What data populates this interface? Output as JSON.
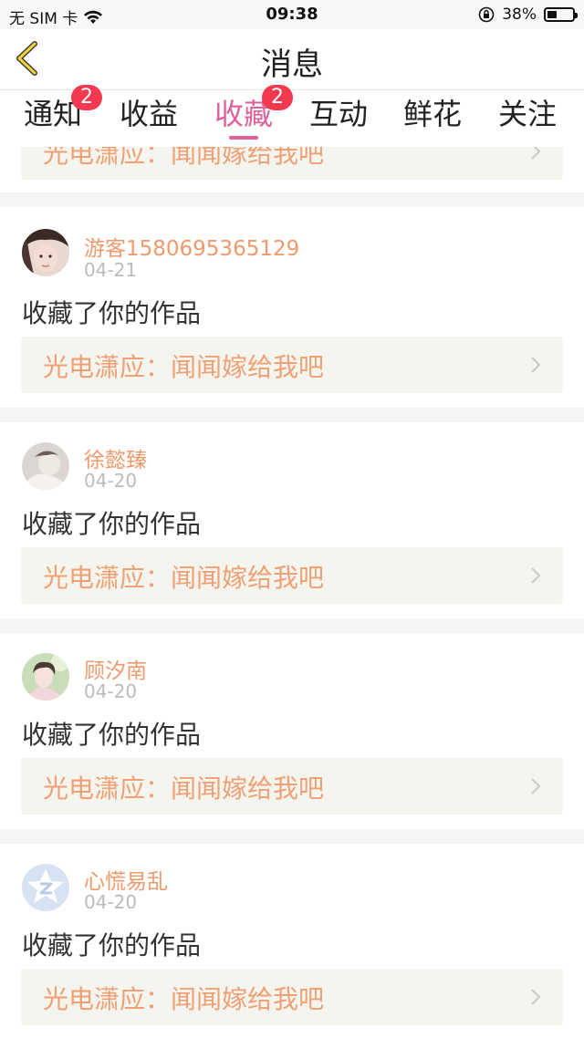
{
  "status_bar": {
    "carrier": "无 SIM 卡",
    "time": "09:38",
    "battery_text": "38%",
    "battery_level": 0.38
  },
  "nav": {
    "title": "消息"
  },
  "tabs": [
    {
      "label": "通知",
      "badge": "2"
    },
    {
      "label": "收益"
    },
    {
      "label": "收藏",
      "badge": "2",
      "active": true
    },
    {
      "label": "互动"
    },
    {
      "label": "鲜花"
    },
    {
      "label": "关注"
    }
  ],
  "partial_card": {
    "work_title": "光电潇应：闻闻嫁给我吧"
  },
  "items": [
    {
      "user": "游客1580695365129",
      "date": "04-21",
      "action": "收藏了你的作品",
      "work_title": "光电潇应：闻闻嫁给我吧"
    },
    {
      "user": "徐懿臻",
      "date": "04-20",
      "action": "收藏了你的作品",
      "work_title": "光电潇应：闻闻嫁给我吧"
    },
    {
      "user": "顾汐南",
      "date": "04-20",
      "action": "收藏了你的作品",
      "work_title": "光电潇应：闻闻嫁给我吧"
    },
    {
      "user": "心慌易乱",
      "date": "04-20",
      "action": "收藏了你的作品",
      "work_title": "光电潇应：闻闻嫁给我吧"
    }
  ],
  "colors": {
    "accent": "#e0609a",
    "badge": "#f2394f",
    "username": "#ef9a6c",
    "work_title": "#f0a073",
    "work_bg": "#f5f5ef"
  }
}
